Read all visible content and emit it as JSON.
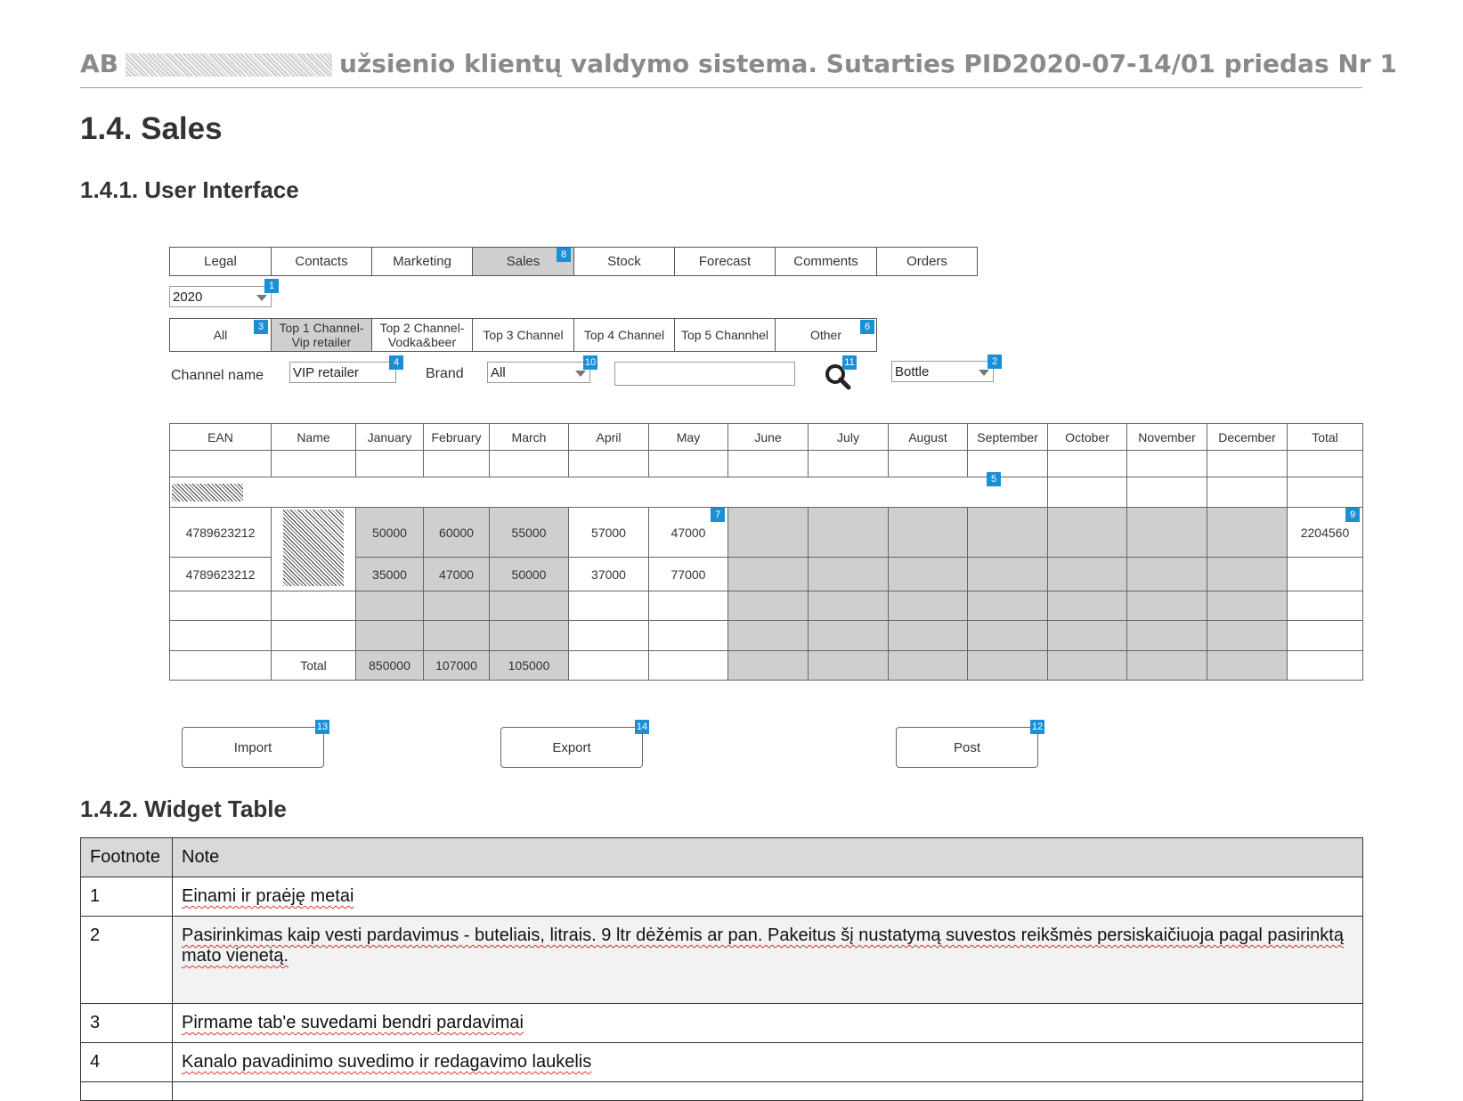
{
  "doc_header": {
    "prefix": "AB",
    "suffix": "užsienio klientų valdymo sistema.  Sutarties PID2020-07-14/01 priedas Nr 1"
  },
  "section": {
    "title": "1.4. Sales",
    "ui_title": "1.4.1. User Interface",
    "widget_title": "1.4.2. Widget Table"
  },
  "tabs": [
    {
      "label": "Legal"
    },
    {
      "label": "Contacts"
    },
    {
      "label": "Marketing"
    },
    {
      "label": "Sales",
      "badge": "8"
    },
    {
      "label": "Stock"
    },
    {
      "label": "Forecast"
    },
    {
      "label": "Comments"
    },
    {
      "label": "Orders"
    }
  ],
  "year_select": {
    "value": "2020",
    "badge": "1"
  },
  "channel_tabs": [
    {
      "label": "All",
      "badge": "3"
    },
    {
      "label": "Top 1 Channel-\nVip retailer"
    },
    {
      "label": "Top 2 Channel-\nVodka&beer"
    },
    {
      "label": "Top 3 Channel"
    },
    {
      "label": "Top 4 Channel"
    },
    {
      "label": "Top 5 Channhel"
    },
    {
      "label": "Other",
      "badge": "6"
    }
  ],
  "filters": {
    "channel_name_label": "Channel name",
    "channel_name_value": "VIP retailer",
    "channel_name_badge": "4",
    "brand_label": "Brand",
    "brand_value": "All",
    "brand_badge": "10",
    "search_value": "",
    "search_badge": "11",
    "unit_value": "Bottle",
    "unit_badge": "2"
  },
  "grid": {
    "headers": [
      "EAN",
      "Name",
      "January",
      "February",
      "March",
      "April",
      "May",
      "June",
      "July",
      "August",
      "September",
      "October",
      "November",
      "December",
      "Total"
    ],
    "row5_badge": "5",
    "may_badge": "7",
    "total_badge": "9",
    "rows": [
      {
        "ean": "4789623212",
        "months": [
          "50000",
          "60000",
          "55000",
          "57000",
          "47000"
        ],
        "total": "2204560"
      },
      {
        "ean": "4789623212",
        "months": [
          "35000",
          "47000",
          "50000",
          "37000",
          "77000"
        ],
        "total": ""
      }
    ],
    "footer_label": "Total",
    "footer_values": [
      "850000",
      "107000",
      "105000"
    ]
  },
  "buttons": {
    "import": "Import",
    "import_badge": "13",
    "export": "Export",
    "export_badge": "14",
    "post": "Post",
    "post_badge": "12"
  },
  "notes": {
    "headers": [
      "Footnote",
      "Note"
    ],
    "rows": [
      {
        "n": "1",
        "text": "Einami ir praėję metai"
      },
      {
        "n": "2",
        "text": "Pasirinkimas kaip vesti pardavimus - buteliais, litrais. 9 ltr dėžėmis ar pan. Pakeitus šį nustatymą suvestos reikšmės persiskaičiuoja pagal pasirinktą mato vienetą."
      },
      {
        "n": "3",
        "text": "Pirmame tab'e suvedami bendri pardavimai"
      },
      {
        "n": "4",
        "text": "Kanalo pavadinimo suvedimo ir redagavimo laukelis"
      }
    ]
  }
}
